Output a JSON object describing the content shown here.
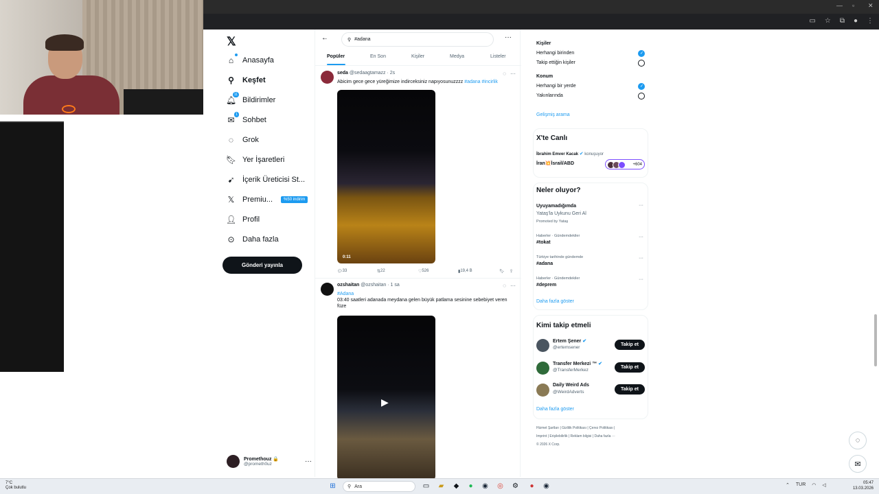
{
  "nav": {
    "items": [
      {
        "label": "Anasayfa",
        "icon": "home-icon"
      },
      {
        "label": "Keşfet",
        "icon": "search-icon"
      },
      {
        "label": "Bildirimler",
        "icon": "bell-icon",
        "badge": "11"
      },
      {
        "label": "Sohbet",
        "icon": "mail-icon",
        "badge": "1"
      },
      {
        "label": "Grok",
        "icon": "grok-icon"
      },
      {
        "label": "Yer İşaretleri",
        "icon": "bookmark-icon"
      },
      {
        "label": "İçerik Üreticisi St...",
        "icon": "rocket-icon"
      },
      {
        "label": "Premiu...",
        "icon": "x-icon",
        "tag": "%50 indirim"
      },
      {
        "label": "Profil",
        "icon": "person-icon"
      },
      {
        "label": "Daha fazla",
        "icon": "more-circle-icon"
      }
    ],
    "post_button": "Gönderi yayınla",
    "profile": {
      "name": "Promethouz 🔒",
      "handle": "@prometh0uz"
    }
  },
  "search": {
    "value": "#adana"
  },
  "tabs": [
    "Popüler",
    "En Son",
    "Kişiler",
    "Medya",
    "Listeler"
  ],
  "tweets": [
    {
      "name": "seda",
      "handle": "@sedaagtamazz",
      "time": "· 2s",
      "text": "Abicim gece gece yüreğimize indirceksiniz napıyosunuzzzz",
      "tags": "#adana #incirlik",
      "duration": "0:11",
      "stats": {
        "replies": "33",
        "reposts": "22",
        "likes": "526",
        "views": "19,4 B"
      }
    },
    {
      "name": "ozshaitan",
      "handle": "@ozshaitan",
      "time": "· 1 sa",
      "tag_line": "#Adana",
      "text": "03:40 saatleri adanada meydana gelen büyük patlama sesinine sebebiyet veren füze"
    }
  ],
  "right": {
    "filters": {
      "people_title": "Kişiler",
      "people_opt1": "Herhangi birinden",
      "people_opt2": "Takip ettiğin kişiler",
      "location_title": "Konum",
      "location_opt1": "Herhangi bir yerde",
      "location_opt2": "Yakınlarında",
      "advanced": "Gelişmiş arama"
    },
    "live": {
      "title": "X'te Canlı",
      "host": "İbrahim Emver Kacak",
      "status": "konuşuyor",
      "topic": "İran💥İsrail/ABD",
      "count": "+604"
    },
    "trends": {
      "title": "Neler oluyor?",
      "promo_name": "Uyuyamadığımda",
      "promo_sub": "Yataş'la Uykunu Geri Al",
      "promo_by": "Promoted by Yataş",
      "items": [
        {
          "context": "Haberler · Gündemdekiler",
          "name": "#tokat"
        },
        {
          "context": "Türkiye tarihinde gündemde",
          "name": "#adana"
        },
        {
          "context": "Haberler · Gündemdekiler",
          "name": "#deprem"
        }
      ],
      "more": "Daha fazla göster"
    },
    "follow": {
      "title": "Kimi takip etmeli",
      "users": [
        {
          "name": "Ertem Şener",
          "handle": "@ertemsener",
          "button": "Takip et"
        },
        {
          "name": "Transfer Merkezi ™",
          "handle": "@TransferMerkez",
          "button": "Takip et"
        },
        {
          "name": "Daily Weird Ads",
          "handle": "@WeirdAdverts",
          "button": "Takip et"
        }
      ],
      "more": "Daha fazla göster"
    },
    "footer": {
      "line1": "Hizmet Şartları  |  Gizlilik Politikası  |  Çerez Politikası  |",
      "line2": "Imprint  |  Erişilebilirlik  |  Reklam bilgisi  |  Daha fazla ···",
      "line3": "© 2026 X Corp."
    }
  },
  "taskbar": {
    "weather_temp": "7°C",
    "weather_desc": "Çok bulutlu",
    "search_placeholder": "Ara",
    "lang": "TUR",
    "time": "05:47",
    "date": "13.03.2026"
  },
  "colors": {
    "accent": "#1d9bf0",
    "text": "#0f1419",
    "muted": "#536471"
  }
}
